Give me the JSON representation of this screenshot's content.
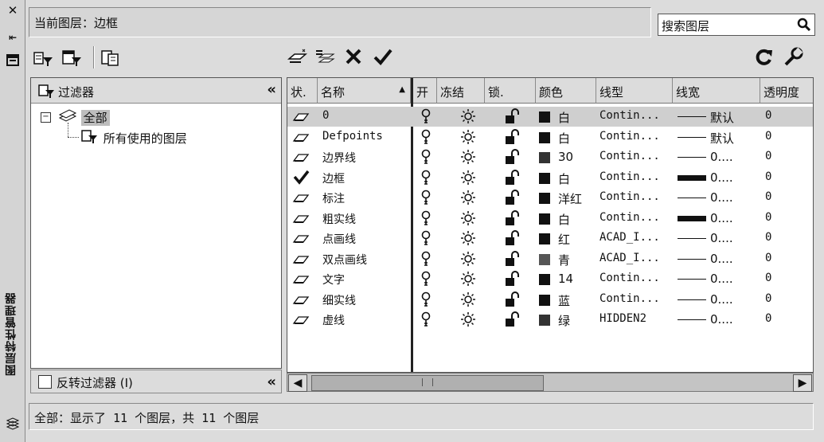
{
  "palette_title": "图层特性管理器",
  "current_layer": "当前图层：边框",
  "search": {
    "placeholder": "搜索图层"
  },
  "filter_panel": {
    "header": "过滤器",
    "tree": [
      {
        "label": "全部",
        "selected": true
      },
      {
        "label": "所有使用的图层",
        "selected": false
      }
    ],
    "invert_label": "反转过滤器 (I)"
  },
  "table": {
    "columns": [
      "状.",
      "名称",
      "开",
      "冻结",
      "锁.",
      "颜色",
      "线型",
      "线宽",
      "透明度"
    ],
    "rows": [
      {
        "status": "layer",
        "name": "0",
        "color_name": "白",
        "color": "#111111",
        "linetype": "Contin...",
        "lineweight": "默认",
        "bold_line": false,
        "transparency": "0",
        "selected": true
      },
      {
        "status": "layer",
        "name": "Defpoints",
        "color_name": "白",
        "color": "#111111",
        "linetype": "Contin...",
        "lineweight": "默认",
        "bold_line": false,
        "transparency": "0",
        "selected": false
      },
      {
        "status": "layer",
        "name": "边界线",
        "color_name": "30",
        "color": "#333333",
        "linetype": "Contin...",
        "lineweight": "0....",
        "bold_line": false,
        "transparency": "0",
        "selected": false
      },
      {
        "status": "current",
        "name": "边框",
        "color_name": "白",
        "color": "#111111",
        "linetype": "Contin...",
        "lineweight": "0....",
        "bold_line": true,
        "transparency": "0",
        "selected": false
      },
      {
        "status": "layer",
        "name": "标注",
        "color_name": "洋红",
        "color": "#111111",
        "linetype": "Contin...",
        "lineweight": "0....",
        "bold_line": false,
        "transparency": "0",
        "selected": false
      },
      {
        "status": "layer",
        "name": "粗实线",
        "color_name": "白",
        "color": "#111111",
        "linetype": "Contin...",
        "lineweight": "0....",
        "bold_line": true,
        "transparency": "0",
        "selected": false
      },
      {
        "status": "layer",
        "name": "点画线",
        "color_name": "红",
        "color": "#111111",
        "linetype": "ACAD_I...",
        "lineweight": "0....",
        "bold_line": false,
        "transparency": "0",
        "selected": false
      },
      {
        "status": "layer",
        "name": "双点画线",
        "color_name": "青",
        "color": "#555555",
        "linetype": "ACAD_I...",
        "lineweight": "0....",
        "bold_line": false,
        "transparency": "0",
        "selected": false
      },
      {
        "status": "layer",
        "name": "文字",
        "color_name": "14",
        "color": "#111111",
        "linetype": "Contin...",
        "lineweight": "0....",
        "bold_line": false,
        "transparency": "0",
        "selected": false
      },
      {
        "status": "layer",
        "name": "细实线",
        "color_name": "蓝",
        "color": "#111111",
        "linetype": "Contin...",
        "lineweight": "0....",
        "bold_line": false,
        "transparency": "0",
        "selected": false
      },
      {
        "status": "layer",
        "name": "虚线",
        "color_name": "绿",
        "color": "#333333",
        "linetype": "HIDDEN2",
        "lineweight": "0....",
        "bold_line": false,
        "transparency": "0",
        "selected": false
      }
    ]
  },
  "status_bar": "全部：显示了 11 个图层，共 11 个图层"
}
